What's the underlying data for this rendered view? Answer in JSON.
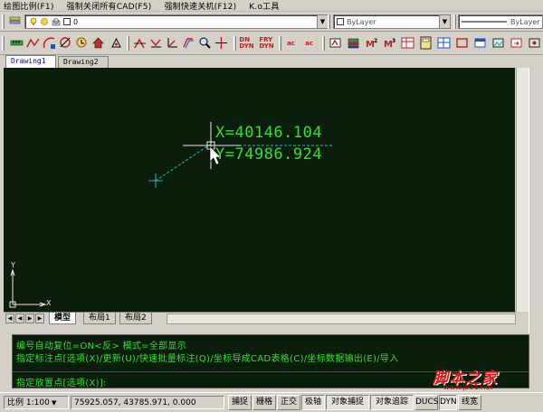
{
  "menu": [
    "绘图比例(F1)",
    "强制关闭所有CAD(F5)",
    "强制快速关机(F12)",
    "K.o工具"
  ],
  "toolbar": {
    "layer_value": "0",
    "color_value": "ByLayer",
    "linetype_value": "ByLayer"
  },
  "tabs": [
    "Drawing1",
    "Drawing2"
  ],
  "drawing": {
    "coord_x_text": "X=40146.104",
    "coord_y_text": "Y=74986.924",
    "ucs_y": "Y",
    "ucs_x": "X",
    "line_color": "#29b6b6",
    "text_color": "#3cdc3c"
  },
  "layout_tabs": [
    "模型",
    "布局1",
    "布局2"
  ],
  "command": {
    "line1": "编号自动复位=ON<反>  模式=全部显示",
    "line2": "指定标注点[选项(X)/更新(U)/快速批量标注(Q)/坐标导成CAD表格(C)/坐标数据输出(E)/导入",
    "line3": "指定放置点[选项(X)]:"
  },
  "status": {
    "scale": "比例 1:100",
    "coords": "75925.057, 43785.971, 0.000",
    "toggles": [
      "捕捉",
      "栅格",
      "正交",
      "极轴",
      "对象捕捉",
      "对象追踪",
      "DUCS",
      "DYN",
      "线宽"
    ]
  },
  "watermark": {
    "main": "脚本之家",
    "sub": "www.jb51.net"
  }
}
